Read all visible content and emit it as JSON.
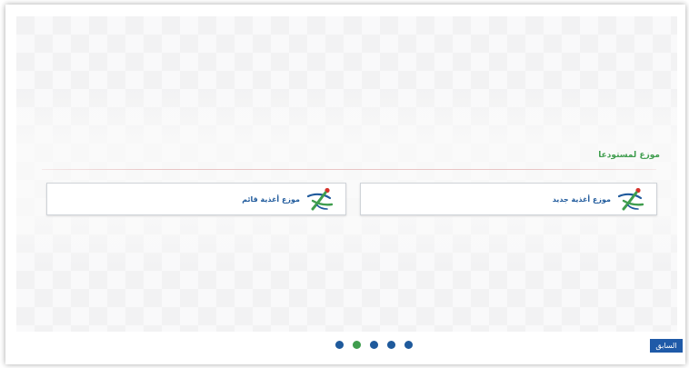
{
  "section": {
    "title": "موزع لمستودعا"
  },
  "cards": [
    {
      "label": "موزع أغذية جديد",
      "logo_icon": "green-runner-logo-icon"
    },
    {
      "label": "موزع أغذية قائم",
      "logo_icon": "green-runner-logo-icon"
    }
  ],
  "pagination": {
    "total": 5,
    "active_index": 1
  },
  "navigation": {
    "prev_label": "السابق"
  },
  "colors": {
    "accent_green": "#3f9d4e",
    "brand_blue": "#1f5a9c",
    "logo_red": "#d6322b"
  }
}
